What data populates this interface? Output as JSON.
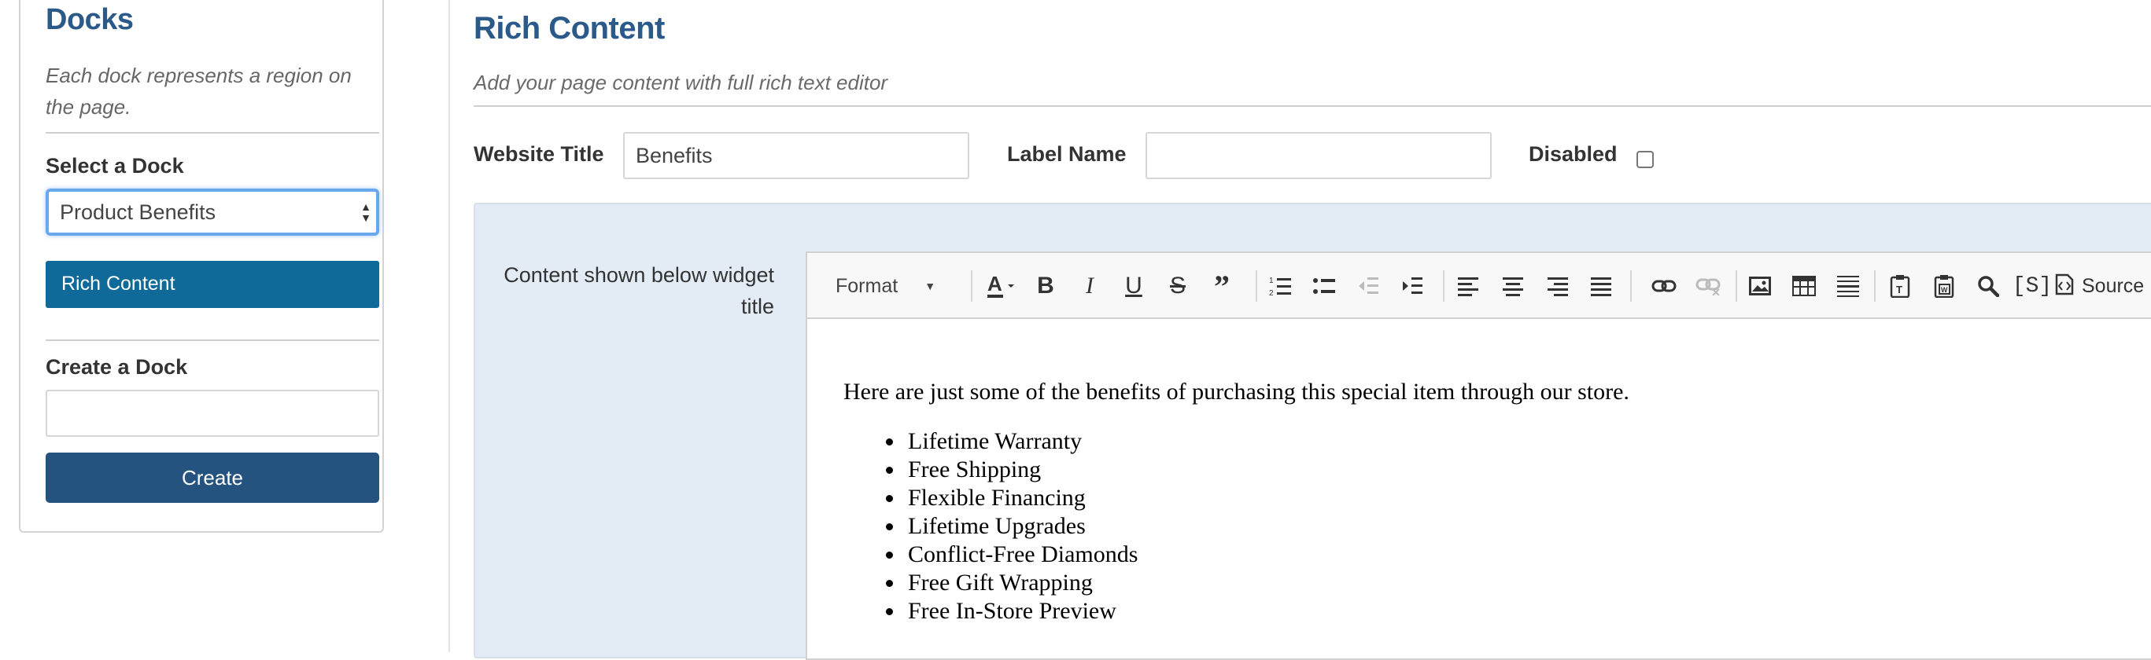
{
  "sidebar": {
    "title": "Docks",
    "description": "Each dock represents a region on the page.",
    "select_label": "Select a Dock",
    "selected_dock": "Product Benefits",
    "rich_content_button": "Rich Content",
    "create_label": "Create a Dock",
    "create_input_value": "",
    "create_button": "Create"
  },
  "main": {
    "title": "Rich Content",
    "description": "Add your page content with full rich text editor",
    "website_title_label": "Website Title",
    "website_title_value": "Benefits",
    "label_name_label": "Label Name",
    "label_name_value": "",
    "disabled_label": "Disabled",
    "disabled_checked": false,
    "content_label": "Content shown below widget title"
  },
  "editor": {
    "toolbar": {
      "format_label": "Format",
      "source_label": "Source",
      "icons": [
        "text-color-icon",
        "bold-icon",
        "italic-icon",
        "underline-icon",
        "strikethrough-icon",
        "blockquote-icon",
        "numbered-list-icon",
        "bulleted-list-icon",
        "outdent-icon",
        "indent-icon",
        "align-left-icon",
        "align-center-icon",
        "align-right-icon",
        "justify-icon",
        "link-icon",
        "unlink-icon",
        "image-icon",
        "table-icon",
        "horizontal-rule-icon",
        "paste-text-icon",
        "paste-word-icon",
        "find-icon",
        "special-char-icon",
        "source-icon"
      ]
    },
    "intro": "Here are just some of the benefits of purchasing this special item through our store.",
    "items": [
      "Lifetime Warranty",
      "Free Shipping",
      "Flexible Financing",
      "Lifetime Upgrades",
      "Conflict-Free Diamonds",
      "Free Gift Wrapping",
      "Free In-Store Preview"
    ]
  },
  "colors": {
    "heading": "#2b5a8a",
    "rich_button": "#0f6a99",
    "create_button": "#24537f",
    "panel_bg": "#e3ecf5"
  }
}
